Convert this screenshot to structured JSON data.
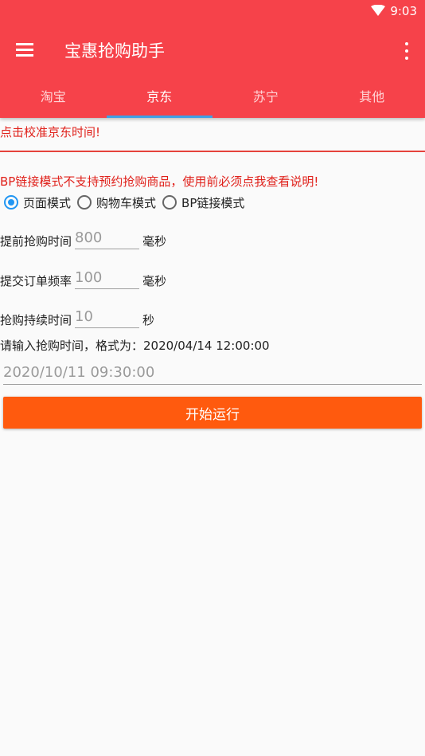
{
  "status": {
    "time": "9:03"
  },
  "app": {
    "title": "宝惠抢购助手"
  },
  "tabs": [
    {
      "label": "淘宝"
    },
    {
      "label": "京东"
    },
    {
      "label": "苏宁"
    },
    {
      "label": "其他"
    }
  ],
  "calibrate_text": "点击校准京东时间!",
  "bp_note": "BP链接模式不支持预约抢购商品，使用前必须点我查看说明!",
  "modes": [
    {
      "label": "页面模式",
      "checked": true
    },
    {
      "label": "购物车模式",
      "checked": false
    },
    {
      "label": "BP链接模式",
      "checked": false
    }
  ],
  "advance": {
    "label": "提前抢购时间",
    "placeholder": "800",
    "unit": "毫秒"
  },
  "frequency": {
    "label": "提交订单频率",
    "placeholder": "100",
    "unit": "毫秒"
  },
  "duration": {
    "label": "抢购持续时间",
    "placeholder": "10",
    "unit": "秒"
  },
  "time_hint": "请输入抢购时间，格式为：2020/04/14 12:00:00",
  "time_input": {
    "placeholder": "2020/10/11 09:30:00"
  },
  "start_button": "开始运行",
  "colors": {
    "primary": "#f6424a",
    "accent": "#2196f3",
    "button": "#ff5a0e",
    "warning_text": "#e0221c"
  }
}
